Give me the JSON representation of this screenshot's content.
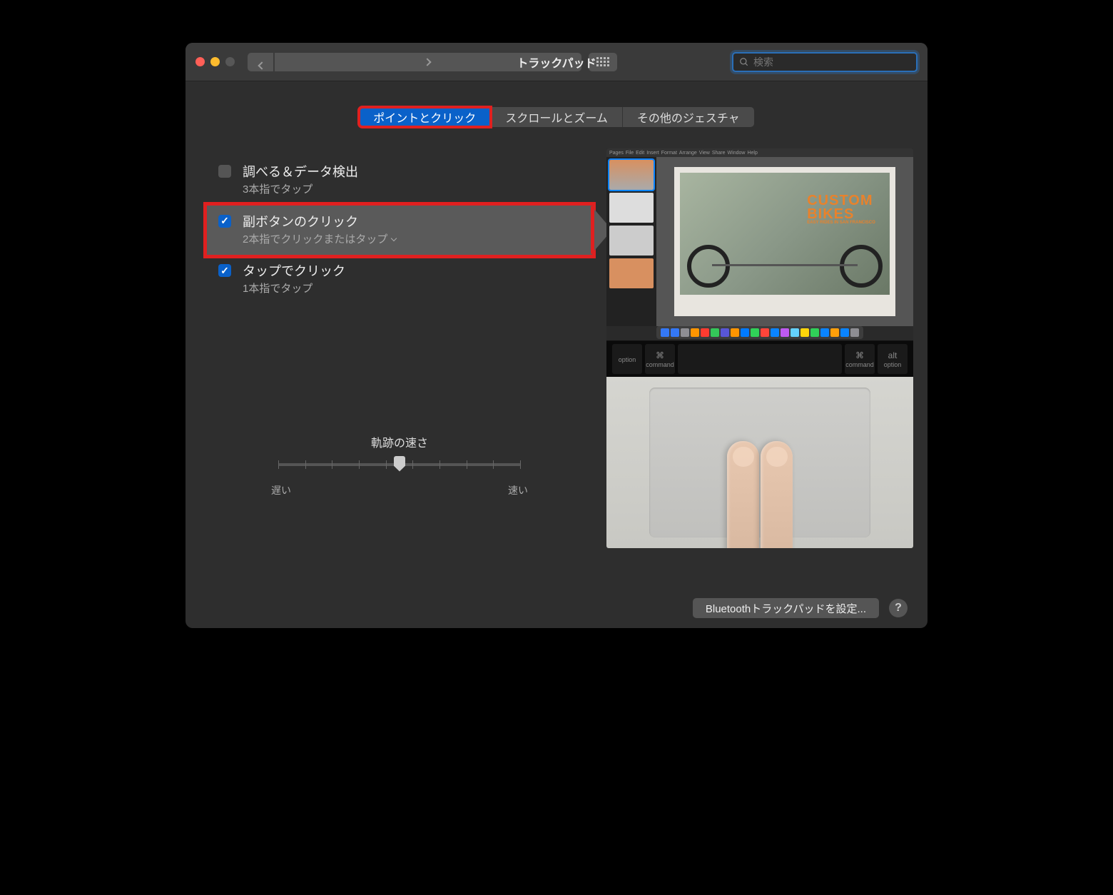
{
  "window": {
    "title": "トラックパッド"
  },
  "search": {
    "placeholder": "検索"
  },
  "tabs": [
    {
      "label": "ポイントとクリック",
      "active": true
    },
    {
      "label": "スクロールとズーム",
      "active": false
    },
    {
      "label": "その他のジェスチャ",
      "active": false
    }
  ],
  "options": [
    {
      "title": "調べる＆データ検出",
      "sub": "3本指でタップ",
      "checked": false,
      "selected": false,
      "dropdown": false
    },
    {
      "title": "副ボタンのクリック",
      "sub": "2本指でクリックまたはタップ",
      "checked": true,
      "selected": true,
      "dropdown": true
    },
    {
      "title": "タップでクリック",
      "sub": "1本指でタップ",
      "checked": true,
      "selected": false,
      "dropdown": false
    }
  ],
  "slider": {
    "label": "軌跡の速さ",
    "min_label": "遅い",
    "max_label": "速い",
    "value": 5,
    "ticks": 10
  },
  "preview": {
    "menubar_items": [
      "Pages",
      "File",
      "Edit",
      "Insert",
      "Format",
      "Arrange",
      "View",
      "Share",
      "Window",
      "Help"
    ],
    "page_title": "CUSTOM",
    "page_title2": "BIKES",
    "page_sub": "EASY RIDES IN SAN FRANCISCO",
    "keys": [
      {
        "sym": "",
        "label": "option",
        "small": true
      },
      {
        "sym": "⌘",
        "label": "command",
        "small": true
      },
      {
        "sym": "",
        "label": "",
        "small": false
      },
      {
        "sym": "⌘",
        "label": "command",
        "small": true
      },
      {
        "sym": "alt",
        "label": "option",
        "small": true
      }
    ],
    "dock_colors": [
      "#3478f6",
      "#3478f6",
      "#8e8e93",
      "#ff9500",
      "#ff3b30",
      "#34c759",
      "#5856d6",
      "#ff9500",
      "#007aff",
      "#30d158",
      "#ff453a",
      "#0a84ff",
      "#bf5af2",
      "#64d2ff",
      "#ffd60a",
      "#30d158",
      "#0a84ff",
      "#ff9f0a",
      "#0a84ff",
      "#8e8e93"
    ]
  },
  "footer": {
    "bt_button": "Bluetoothトラックパッドを設定...",
    "help": "?"
  }
}
